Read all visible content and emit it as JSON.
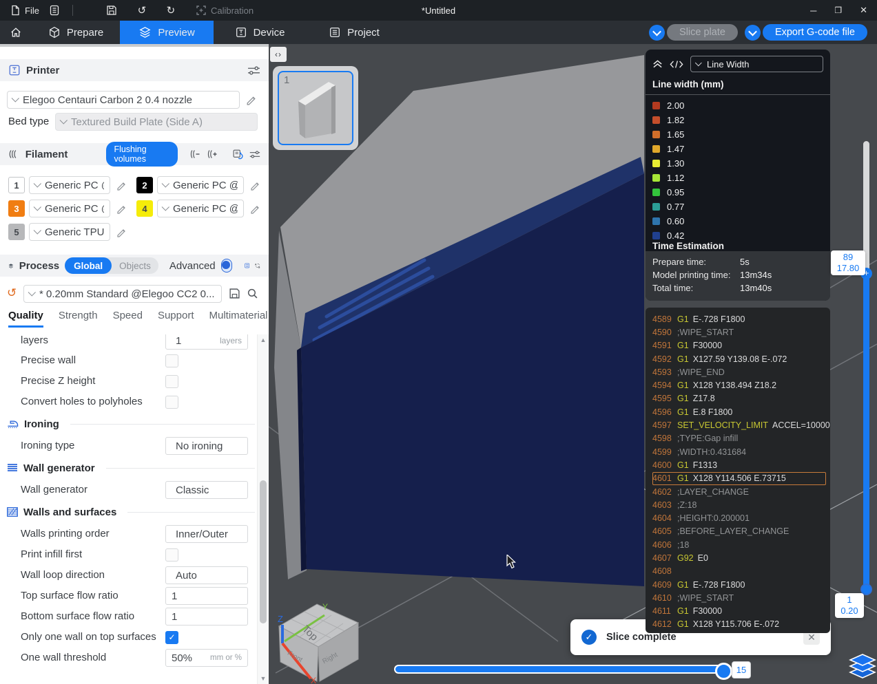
{
  "window": {
    "title": "*Untitled",
    "menu": {
      "file": "File",
      "calibration": "Calibration"
    },
    "controls": [
      "minimize",
      "maximize",
      "close"
    ]
  },
  "nav": {
    "tabs": [
      {
        "label": "Prepare",
        "active": false
      },
      {
        "label": "Preview",
        "active": true
      },
      {
        "label": "Device",
        "active": false
      },
      {
        "label": "Project",
        "active": false
      }
    ],
    "slice_label": "Slice plate",
    "export_label": "Export G-code file",
    "accent": "#187af2"
  },
  "printer": {
    "header": "Printer",
    "preset": "Elegoo Centauri Carbon 2 0.4 nozzle",
    "bed_type_label": "Bed type",
    "bed_type": "Textured Build Plate (Side A)"
  },
  "filament": {
    "header": "Filament",
    "flushing_label": "Flushing volumes",
    "slots": [
      {
        "id": "1",
        "label": "Generic PC @E...",
        "color": "#ffffff",
        "text": "#44484d",
        "border": "#c3c5c7"
      },
      {
        "id": "2",
        "label": "Generic PC @Ele...",
        "color": "#000000",
        "text": "#ffffff",
        "border": "#000000"
      },
      {
        "id": "3",
        "label": "Generic PC @E...",
        "color": "#f07d12",
        "text": "#ffffff",
        "border": "#f07d12"
      },
      {
        "id": "4",
        "label": "Generic PC @Ele...",
        "color": "#f5ec0a",
        "text": "#44484d",
        "border": "#f5ec0a"
      },
      {
        "id": "5",
        "label": "Generic TPU",
        "color": "#b7b8ba",
        "text": "#44484d",
        "border": "#b7b8ba"
      }
    ]
  },
  "process": {
    "header": "Process",
    "global_label": "Global",
    "objects_label": "Objects",
    "advanced_label": "Advanced",
    "preset": "* 0.20mm Standard @Elegoo CC2 0...",
    "tabs": [
      "Quality",
      "Strength",
      "Speed",
      "Support",
      "Multimaterial"
    ],
    "active_tab": "Quality"
  },
  "settings": {
    "rows": [
      {
        "type": "setting",
        "label": "layers",
        "control": "select-unit",
        "value": "1",
        "unit": "layers",
        "partial": true
      },
      {
        "type": "setting",
        "label": "Precise wall",
        "control": "checkbox",
        "checked": false
      },
      {
        "type": "setting",
        "label": "Precise Z height",
        "control": "checkbox",
        "checked": false
      },
      {
        "type": "setting",
        "label": "Convert holes to polyholes",
        "control": "checkbox",
        "checked": false
      },
      {
        "type": "section",
        "label": "Ironing",
        "icon": "iron-icon"
      },
      {
        "type": "setting",
        "label": "Ironing type",
        "control": "select",
        "value": "No ironing"
      },
      {
        "type": "section",
        "label": "Wall generator",
        "icon": "wall-generator-icon"
      },
      {
        "type": "setting",
        "label": "Wall generator",
        "control": "select",
        "value": "Classic"
      },
      {
        "type": "section",
        "label": "Walls and surfaces",
        "icon": "walls-surfaces-icon"
      },
      {
        "type": "setting",
        "label": "Walls printing order",
        "control": "select",
        "value": "Inner/Outer"
      },
      {
        "type": "setting",
        "label": "Print infill first",
        "control": "checkbox",
        "checked": false
      },
      {
        "type": "setting",
        "label": "Wall loop direction",
        "control": "select",
        "value": "Auto"
      },
      {
        "type": "setting",
        "label": "Top surface flow ratio",
        "control": "input",
        "value": "1"
      },
      {
        "type": "setting",
        "label": "Bottom surface flow ratio",
        "control": "input",
        "value": "1"
      },
      {
        "type": "setting",
        "label": "Only one wall on top surfaces",
        "control": "checkbox",
        "checked": true
      },
      {
        "type": "setting",
        "label": "One wall threshold",
        "control": "input-unit",
        "value": "50%",
        "unit": "mm or %"
      }
    ]
  },
  "viewport": {
    "plate_number": "1",
    "collapse_glyph": "‹›",
    "cube": {
      "top": "Top",
      "front": "Front",
      "right": "Right",
      "x": "X",
      "y": "Y",
      "z": "Z"
    },
    "layer_slider": {
      "top_value": "89",
      "top_height": "17.80",
      "bottom_value": "1",
      "bottom_height": "0.20"
    },
    "move_slider_value": "15"
  },
  "legend": {
    "view_mode": "Line Width",
    "title": "Line width (mm)",
    "entries": [
      {
        "value": "2.00",
        "color": "#b23a20"
      },
      {
        "value": "1.82",
        "color": "#c44e2b"
      },
      {
        "value": "1.65",
        "color": "#d06e2a"
      },
      {
        "value": "1.47",
        "color": "#dfa72b"
      },
      {
        "value": "1.30",
        "color": "#e7ec33"
      },
      {
        "value": "1.12",
        "color": "#a7e637"
      },
      {
        "value": "0.95",
        "color": "#33c43c"
      },
      {
        "value": "0.77",
        "color": "#2b9e96"
      },
      {
        "value": "0.60",
        "color": "#2e74ad"
      },
      {
        "value": "0.42",
        "color": "#20408f"
      }
    ],
    "time": {
      "header": "Time Estimation",
      "rows": [
        {
          "label": "Prepare time:",
          "value": "5s"
        },
        {
          "label": "Model printing time:",
          "value": "13m34s"
        },
        {
          "label": "Total time:",
          "value": "13m40s"
        }
      ]
    }
  },
  "gcode": {
    "lines": [
      {
        "n": "4589",
        "c": "G1",
        "t": "E-.728 F1800"
      },
      {
        "n": "4590",
        "comment": ";WIPE_START"
      },
      {
        "n": "4591",
        "c": "G1",
        "t": "F30000"
      },
      {
        "n": "4592",
        "c": "G1",
        "t": "X127.59 Y139.08 E-.072"
      },
      {
        "n": "4593",
        "comment": ";WIPE_END"
      },
      {
        "n": "4594",
        "c": "G1",
        "t": "X128 Y138.494 Z18.2"
      },
      {
        "n": "4595",
        "c": "G1",
        "t": "Z17.8"
      },
      {
        "n": "4596",
        "c": "G1",
        "t": "E.8 F1800"
      },
      {
        "n": "4597",
        "c": "SET_VELOCITY_LIMIT",
        "t": "ACCEL=10000"
      },
      {
        "n": "4598",
        "comment": ";TYPE:Gap infill"
      },
      {
        "n": "4599",
        "comment": ";WIDTH:0.431684"
      },
      {
        "n": "4600",
        "c": "G1",
        "t": "F1313"
      },
      {
        "n": "4601",
        "c": "G1",
        "t": "X128 Y114.506 E.73715",
        "selected": true
      },
      {
        "n": "4602",
        "comment": ";LAYER_CHANGE"
      },
      {
        "n": "4603",
        "comment": ";Z:18"
      },
      {
        "n": "4604",
        "comment": ";HEIGHT:0.200001"
      },
      {
        "n": "4605",
        "comment": ";BEFORE_LAYER_CHANGE"
      },
      {
        "n": "4606",
        "comment": ";18"
      },
      {
        "n": "4607",
        "c": "G92",
        "t": "E0"
      },
      {
        "n": "4608"
      },
      {
        "n": "4609",
        "c": "G1",
        "t": "E-.728 F1800"
      },
      {
        "n": "4610",
        "comment": ";WIPE_START"
      },
      {
        "n": "4611",
        "c": "G1",
        "t": "F30000"
      },
      {
        "n": "4612",
        "c": "G1",
        "t": "X128 Y115.706 E-.072"
      }
    ]
  },
  "toast": {
    "message": "Slice complete"
  }
}
